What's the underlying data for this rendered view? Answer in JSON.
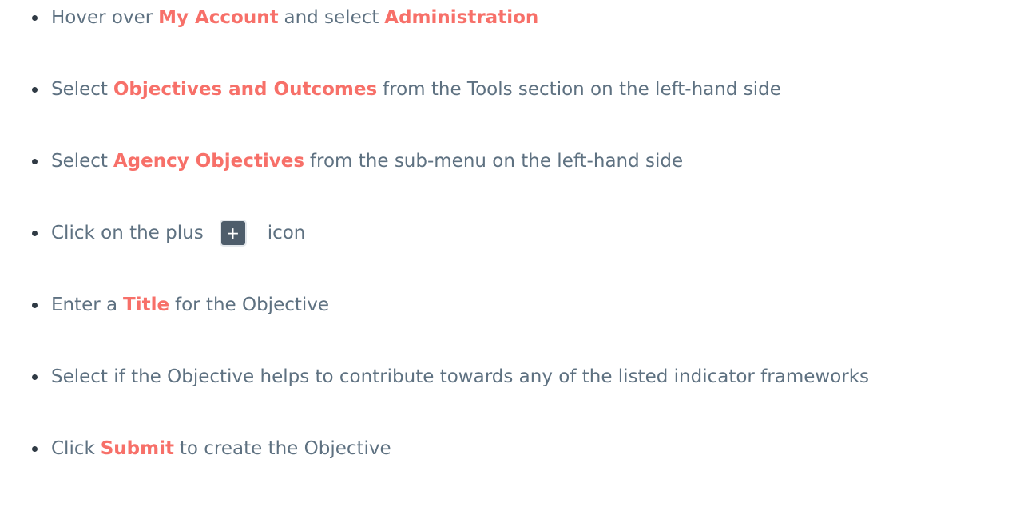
{
  "steps": [
    {
      "before": "Hover over",
      "hl1": "My Account",
      "mid": "and select",
      "hl2": "Administration"
    },
    {
      "before": "Select",
      "hl": "Objectives and Outcomes",
      "after": "from the Tools section on the left-hand side"
    },
    {
      "before": "Select",
      "hl": "Agency Objectives",
      "after": "from the sub-menu on the left-hand side"
    },
    {
      "before": "Click on the plus",
      "icon_glyph": "+",
      "icon": "plus-icon",
      "after": "icon"
    },
    {
      "before": "Enter a",
      "hl": "Title",
      "after": "for the Objective"
    },
    {
      "text": "Select if the Objective helps to contribute towards any of the listed indicator frameworks"
    },
    {
      "before": "Click",
      "hl": "Submit",
      "after": "to create the Objective"
    }
  ],
  "colors": {
    "text": "#5e7181",
    "highlight": "#f77069",
    "bullet": "#2f3a44",
    "icon_bg": "#4e5d6b"
  }
}
